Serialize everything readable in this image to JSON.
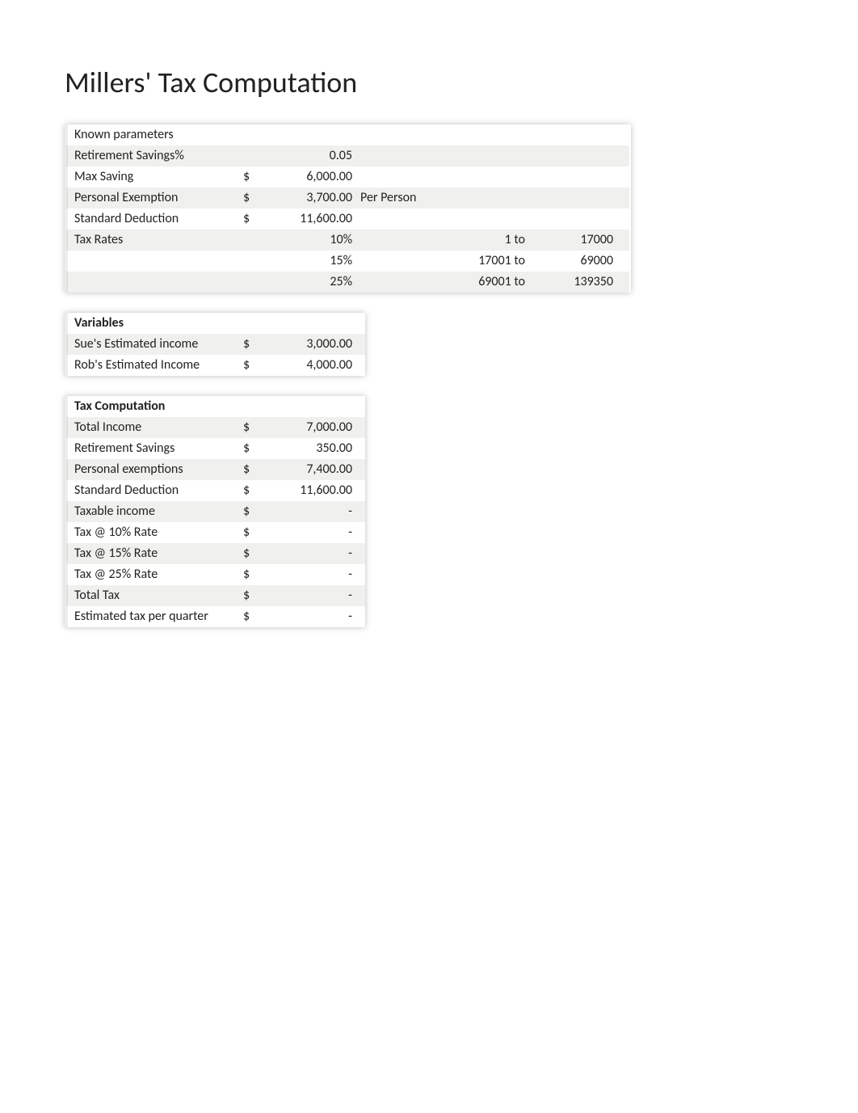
{
  "title": "Millers' Tax Computation",
  "known": {
    "heading": "Known parameters",
    "retirement_pct": {
      "label": "Retirement Savings%",
      "value": "0.05"
    },
    "max_saving": {
      "label": "Max Saving",
      "currency": "$",
      "value": "6,000.00"
    },
    "personal_ex": {
      "label": "Personal Exemption",
      "currency": "$",
      "value": "3,700.00",
      "note": "Per Person"
    },
    "std_deduction": {
      "label": "Standard Deduction",
      "currency": "$",
      "value": "11,600.00"
    },
    "tax_rates_label": "Tax Rates",
    "brackets": [
      {
        "rate": "10%",
        "from": "1 to",
        "to": "17000"
      },
      {
        "rate": "15%",
        "from": "17001 to",
        "to": "69000"
      },
      {
        "rate": "25%",
        "from": "69001 to",
        "to": "139350"
      }
    ]
  },
  "variables": {
    "heading": "Variables",
    "rows": [
      {
        "label": "Sue's Estimated income",
        "currency": "$",
        "value": "3,000.00"
      },
      {
        "label": "Rob's Estimated Income",
        "currency": "$",
        "value": "4,000.00"
      }
    ]
  },
  "computation": {
    "heading": "Tax Computation",
    "rows": [
      {
        "label": "Total Income",
        "currency": "$",
        "value": "7,000.00"
      },
      {
        "label": "Retirement Savings",
        "currency": "$",
        "value": "350.00"
      },
      {
        "label": "Personal exemptions",
        "currency": "$",
        "value": "7,400.00"
      },
      {
        "label": "Standard Deduction",
        "currency": "$",
        "value": "11,600.00"
      },
      {
        "label": "Taxable income",
        "currency": "$",
        "value": "-"
      },
      {
        "label": "Tax @ 10% Rate",
        "currency": "$",
        "value": "-"
      },
      {
        "label": "Tax @ 15% Rate",
        "currency": "$",
        "value": "-"
      },
      {
        "label": "Tax @ 25% Rate",
        "currency": "$",
        "value": "-"
      },
      {
        "label": "Total Tax",
        "currency": "$",
        "value": "-"
      },
      {
        "label": "Estimated tax per quarter",
        "currency": "$",
        "value": "-"
      }
    ]
  }
}
